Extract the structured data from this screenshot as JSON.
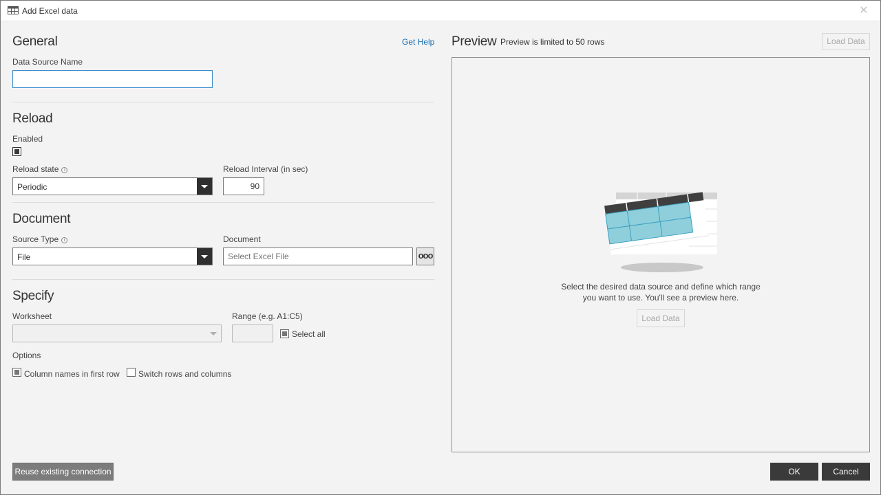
{
  "window": {
    "title": "Add Excel data",
    "close_glyph": "✕"
  },
  "general": {
    "title": "General",
    "help_link": "Get Help",
    "data_source_name_label": "Data Source Name",
    "data_source_name_value": ""
  },
  "reload": {
    "title": "Reload",
    "enabled_label": "Enabled",
    "enabled_checked": true,
    "state_label": "Reload state",
    "state_value": "Periodic",
    "interval_label": "Reload Interval (in sec)",
    "interval_value": "90"
  },
  "document": {
    "title": "Document",
    "source_type_label": "Source Type",
    "source_type_value": "File",
    "document_label": "Document",
    "document_placeholder": "Select Excel File",
    "browse_glyph": "ooo"
  },
  "specify": {
    "title": "Specify",
    "worksheet_label": "Worksheet",
    "worksheet_value": "",
    "range_label": "Range (e.g. A1:C5)",
    "range_value": "",
    "select_all_label": "Select all",
    "select_all_checked": true,
    "options_label": "Options",
    "column_names_label": "Column names in first row",
    "column_names_checked": true,
    "switch_rows_label": "Switch rows and columns",
    "switch_rows_checked": false
  },
  "preview": {
    "title": "Preview",
    "subtitle": "Preview is limited to 50 rows",
    "load_data_top": "Load Data",
    "message_line1": "Select the desired data source and define which range",
    "message_line2": "you want to use. You'll see a preview here.",
    "load_data_center": "Load Data"
  },
  "footer": {
    "reuse_label": "Reuse existing connection",
    "ok_label": "OK",
    "cancel_label": "Cancel"
  },
  "icons": {
    "app_icon": "table-grid-icon",
    "info_icon": "info-icon",
    "illustration": "spreadsheet-illustration"
  },
  "colors": {
    "accent_link": "#1a6fb0",
    "focus_border": "#3a8dc9",
    "dark_button": "#3a3a3a",
    "grey_button": "#7c7c7c",
    "sheet_cells": "#8fcfdb"
  }
}
